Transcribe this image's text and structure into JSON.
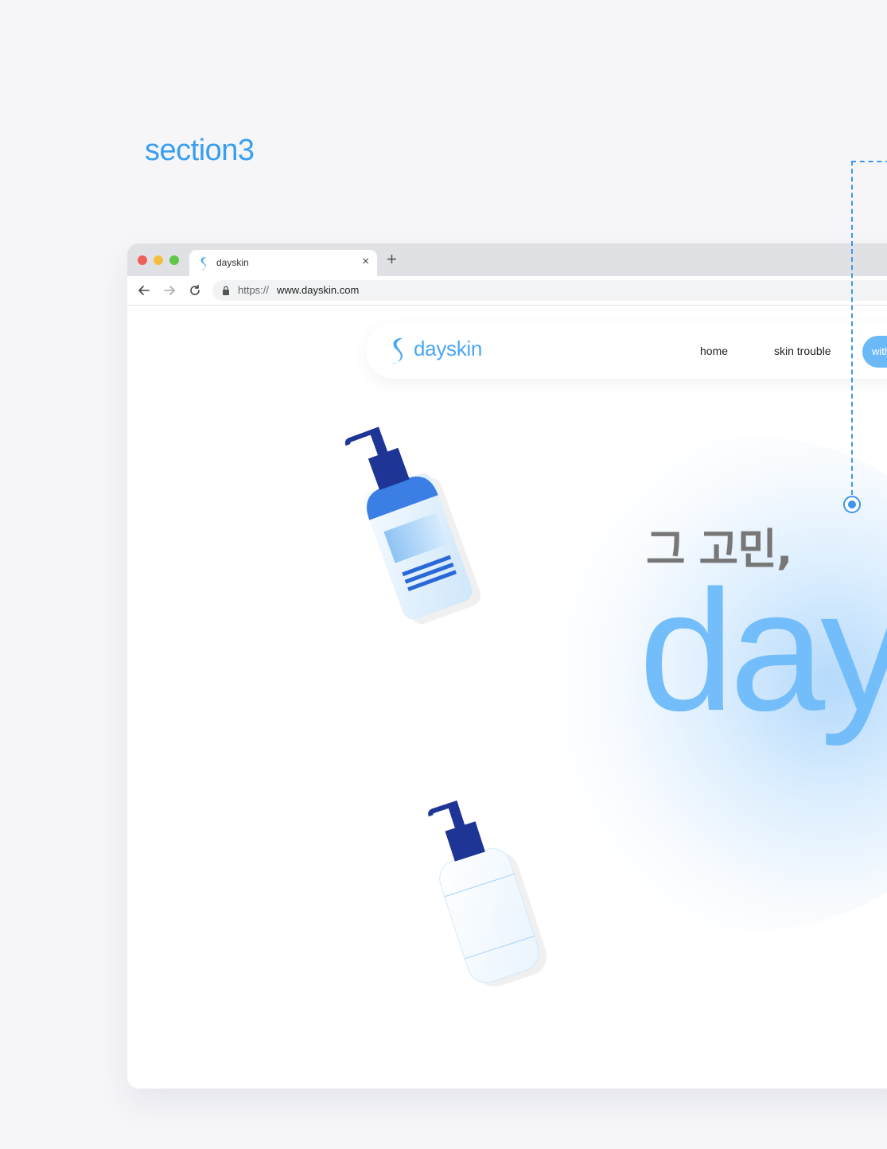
{
  "section_label": "section3",
  "browser": {
    "tab": {
      "title": "dayskin",
      "close_glyph": "×"
    },
    "new_tab_glyph": "+",
    "address": {
      "protocol": "https://",
      "host": "www.dayskin.com"
    },
    "icons": [
      "back-arrow-icon",
      "forward-arrow-icon",
      "reload-icon",
      "lock-icon"
    ]
  },
  "site": {
    "logo_text": "dayskin",
    "nav": {
      "home": "home",
      "skin_trouble": "skin trouble",
      "cta": "with"
    },
    "hero": {
      "subtitle": "그 고민,",
      "title": "dayskin"
    }
  },
  "colors": {
    "accent": "#4ba7f5",
    "hero_text": "#72bdfa",
    "connector": "#3d96ee",
    "page_bg": "#f6f6f9"
  }
}
